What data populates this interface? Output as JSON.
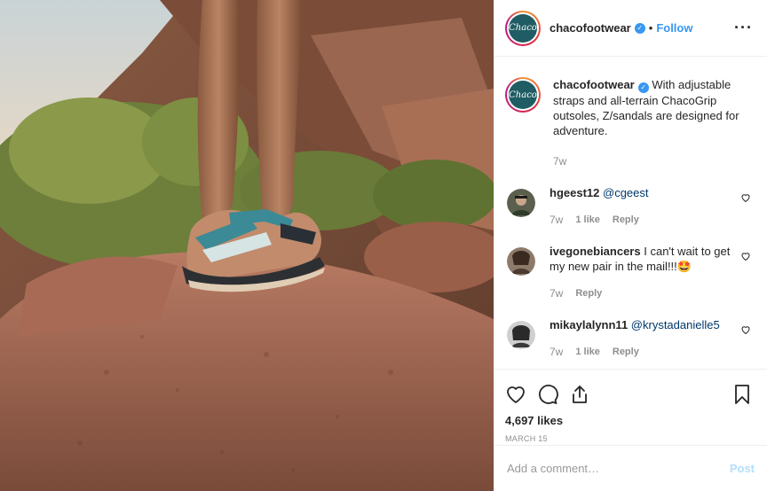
{
  "header": {
    "username": "chacofootwear",
    "separator": "•",
    "follow_label": "Follow",
    "more_label": "···",
    "logo_text": "Chaco"
  },
  "caption": {
    "username": "chacofootwear",
    "text": "With adjustable straps and all-terrain ChacoGrip outsoles, Z/sandals are designed for adventure.",
    "age": "7w"
  },
  "comments": [
    {
      "username": "hgeest12",
      "text": "@cgeest",
      "is_mention": true,
      "age": "7w",
      "likes": "1 like",
      "reply": "Reply"
    },
    {
      "username": "ivegonebiancers",
      "text": "I can't wait to get my new pair in the mail!!!",
      "emoji": "🤩",
      "age": "7w",
      "likes": "",
      "reply": "Reply"
    },
    {
      "username": "mikaylalynn11",
      "text": "@krystadanielle5",
      "is_mention": true,
      "age": "7w",
      "likes": "1 like",
      "reply": "Reply"
    }
  ],
  "actions": {
    "likes": "4,697 likes",
    "date": "MARCH 15"
  },
  "add_comment": {
    "placeholder": "Add a comment…",
    "post_label": "Post"
  },
  "colors": {
    "accent": "#3897f0",
    "post_disabled": "#b2dffc",
    "brand": "#1f5c63"
  }
}
